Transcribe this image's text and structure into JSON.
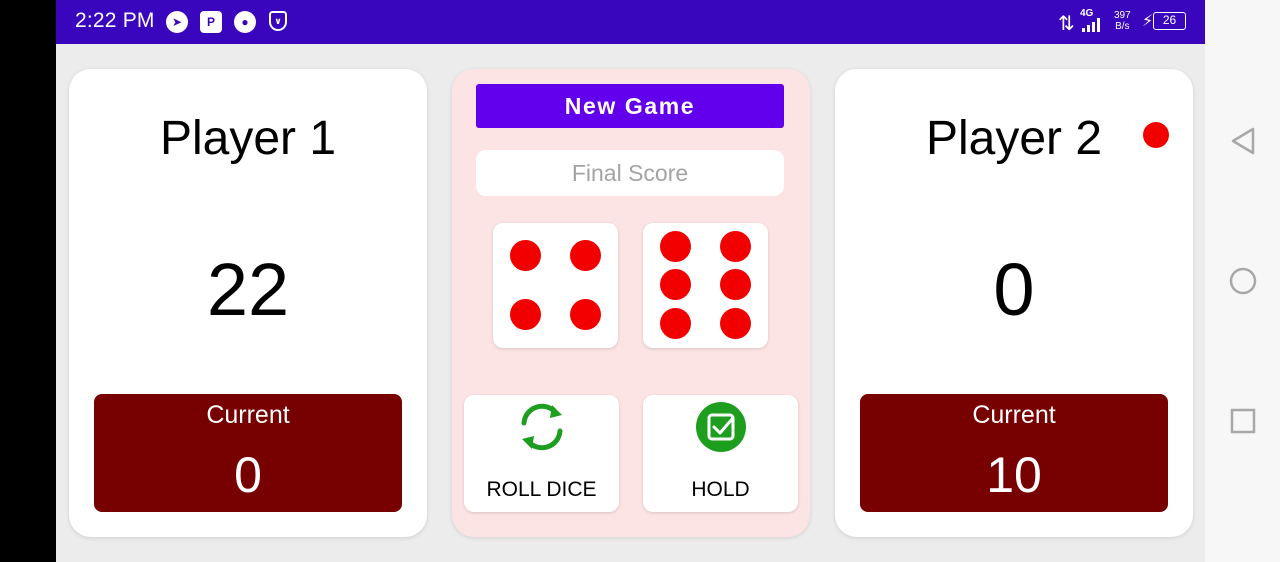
{
  "status_bar": {
    "time": "2:22 PM",
    "network_type": "4G",
    "speed_value": "397",
    "speed_unit": "B/s",
    "battery": "26"
  },
  "player1": {
    "name": "Player 1",
    "score": "22",
    "current_label": "Current",
    "current_value": "0",
    "active": false
  },
  "player2": {
    "name": "Player 2",
    "score": "0",
    "current_label": "Current",
    "current_value": "10",
    "active": true
  },
  "controls": {
    "new_game_label": "New Game",
    "final_score_placeholder": "Final Score",
    "roll_label": "ROLL DICE",
    "hold_label": "HOLD"
  },
  "dice": [
    4,
    6
  ],
  "colors": {
    "status_bar": "#3a06bd",
    "new_game_button": "#6200ee",
    "current_box": "#770000",
    "pip": "#f20000",
    "active_indicator": "#f20000",
    "center_card": "#fde4e4",
    "icon_green": "#1e9e1e"
  },
  "icons": {
    "roll": "refresh-icon",
    "hold": "check-square-icon",
    "nav_back": "triangle-back-icon",
    "nav_home": "circle-home-icon",
    "nav_recents": "square-recents-icon"
  }
}
